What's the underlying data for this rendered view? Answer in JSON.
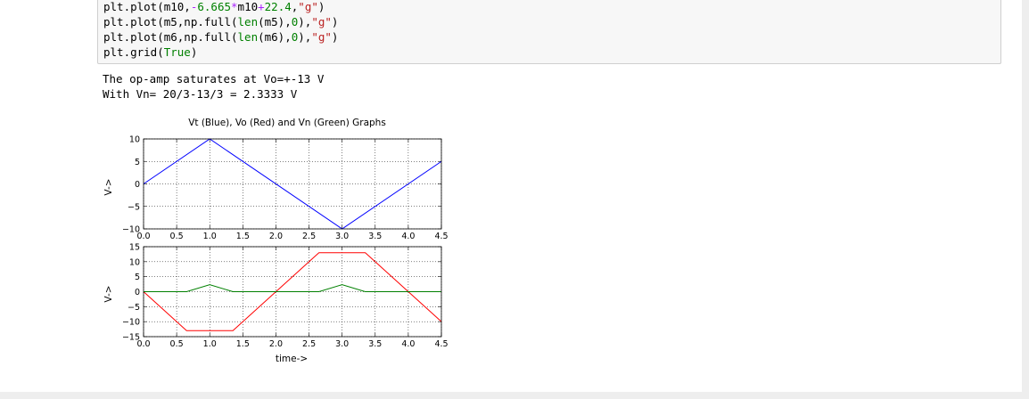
{
  "code": {
    "lines": [
      [
        {
          "t": "plt.plot(m10,",
          "c": ""
        },
        {
          "t": "-",
          "c": "op"
        },
        {
          "t": "6.665",
          "c": "num"
        },
        {
          "t": "*",
          "c": "op"
        },
        {
          "t": "m10",
          "c": ""
        },
        {
          "t": "+",
          "c": "op"
        },
        {
          "t": "22.4",
          "c": "num"
        },
        {
          "t": ",",
          "c": ""
        },
        {
          "t": "\"g\"",
          "c": "str"
        },
        {
          "t": ")",
          "c": ""
        }
      ],
      [
        {
          "t": "plt.plot(m5,np.full(",
          "c": ""
        },
        {
          "t": "len",
          "c": "kw"
        },
        {
          "t": "(m5),",
          "c": ""
        },
        {
          "t": "0",
          "c": "num"
        },
        {
          "t": "),",
          "c": ""
        },
        {
          "t": "\"g\"",
          "c": "str"
        },
        {
          "t": ")",
          "c": ""
        }
      ],
      [
        {
          "t": "plt.plot(m6,np.full(",
          "c": ""
        },
        {
          "t": "len",
          "c": "kw"
        },
        {
          "t": "(m6),",
          "c": ""
        },
        {
          "t": "0",
          "c": "num"
        },
        {
          "t": "),",
          "c": ""
        },
        {
          "t": "\"g\"",
          "c": "str"
        },
        {
          "t": ")",
          "c": ""
        }
      ],
      [
        {
          "t": "plt.grid(",
          "c": ""
        },
        {
          "t": "True",
          "c": "kw"
        },
        {
          "t": ")",
          "c": ""
        }
      ]
    ]
  },
  "output": {
    "line1": "The op-amp saturates at Vo=+-13 V",
    "line2": "With Vn= 20/3-13/3 = 2.3333 V"
  },
  "chart_data": [
    {
      "type": "line",
      "title": "Vt (Blue), Vo (Red) and Vn (Green) Graphs",
      "xlabel": "",
      "ylabel": "V->",
      "xlim": [
        0,
        4.5
      ],
      "ylim": [
        -10,
        10
      ],
      "xticks": [
        "0.0",
        "0.5",
        "1.0",
        "1.5",
        "2.0",
        "2.5",
        "3.0",
        "3.5",
        "4.0",
        "4.5"
      ],
      "yticks": [
        "10",
        "5",
        "0",
        "−5",
        "−10"
      ],
      "grid": true,
      "series": [
        {
          "color": "#0000ff",
          "x": [
            0,
            1,
            3,
            4.5
          ],
          "y": [
            0,
            10,
            -10,
            5
          ]
        }
      ]
    },
    {
      "type": "line",
      "title": "",
      "xlabel": "time->",
      "ylabel": "V->",
      "xlim": [
        0,
        4.5
      ],
      "ylim": [
        -15,
        15
      ],
      "xticks": [
        "0.0",
        "0.5",
        "1.0",
        "1.5",
        "2.0",
        "2.5",
        "3.0",
        "3.5",
        "4.0",
        "4.5"
      ],
      "yticks": [
        "15",
        "10",
        "5",
        "0",
        "−5",
        "−10",
        "−15"
      ],
      "grid": true,
      "series": [
        {
          "color": "#ff0000",
          "x": [
            0,
            0.65,
            1.35,
            2.65,
            3.35,
            4.5
          ],
          "y": [
            0,
            -13,
            -13,
            13,
            13,
            -10
          ]
        },
        {
          "color": "#008000",
          "x": [
            0,
            0.65,
            1.0,
            1.35,
            2.65,
            3.0,
            3.35,
            4.5
          ],
          "y": [
            0,
            0,
            2.3333,
            0,
            0,
            2.3333,
            0,
            0
          ]
        }
      ]
    }
  ]
}
